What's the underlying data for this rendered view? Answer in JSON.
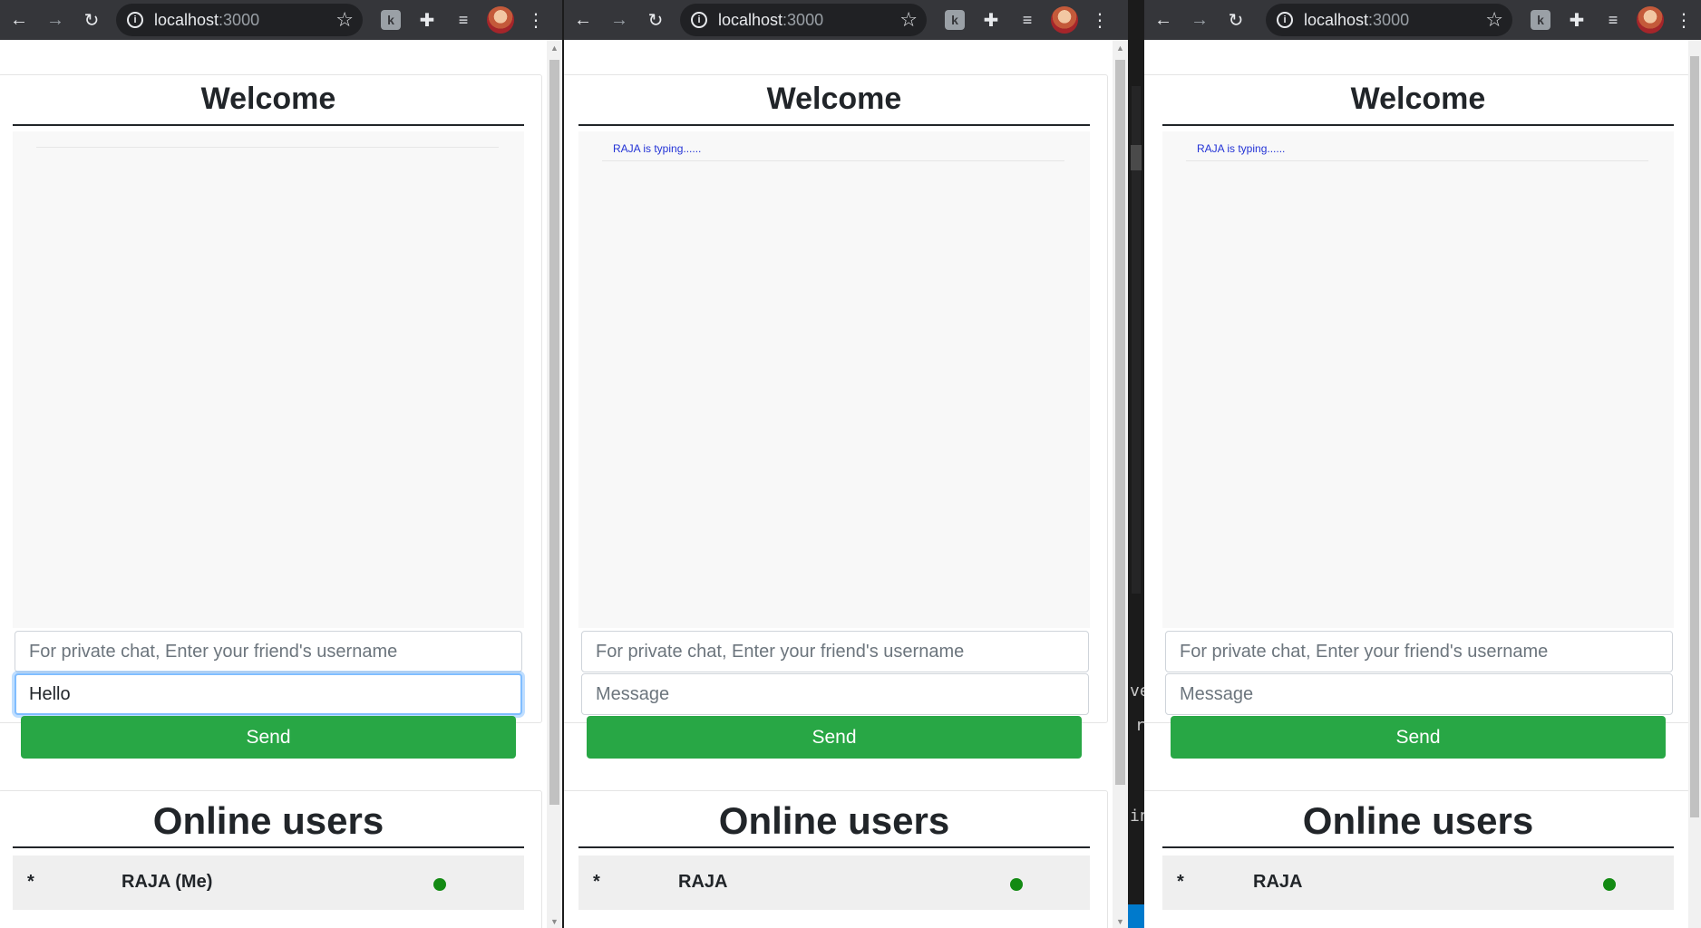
{
  "browser": {
    "url_host": "localhost",
    "url_port": ":3000",
    "extension_letter": "k"
  },
  "chat": {
    "title": "Welcome",
    "private_placeholder": "For private chat, Enter your friend's username",
    "message_placeholder": "Message",
    "send_label": "Send",
    "typing_text": "RAJA is typing......"
  },
  "windows": [
    {
      "message_value": "Hello",
      "typing_visible": false,
      "user": {
        "marker": "*",
        "name": "RAJA (Me)",
        "status": "online"
      }
    },
    {
      "message_value": "",
      "typing_visible": true,
      "user": {
        "marker": "*",
        "name": "RAJA",
        "status": "online"
      }
    },
    {
      "message_value": "",
      "typing_visible": true,
      "user": {
        "marker": "*",
        "name": "RAJA",
        "status": "online"
      }
    }
  ],
  "online_users": {
    "title": "Online users"
  },
  "background_editor": {
    "fragments": [
      "ve",
      "r",
      "in"
    ]
  },
  "colors": {
    "send": "#28a745",
    "typing": "#2232d6",
    "online": "#138a13",
    "toolbar": "#35363a"
  }
}
